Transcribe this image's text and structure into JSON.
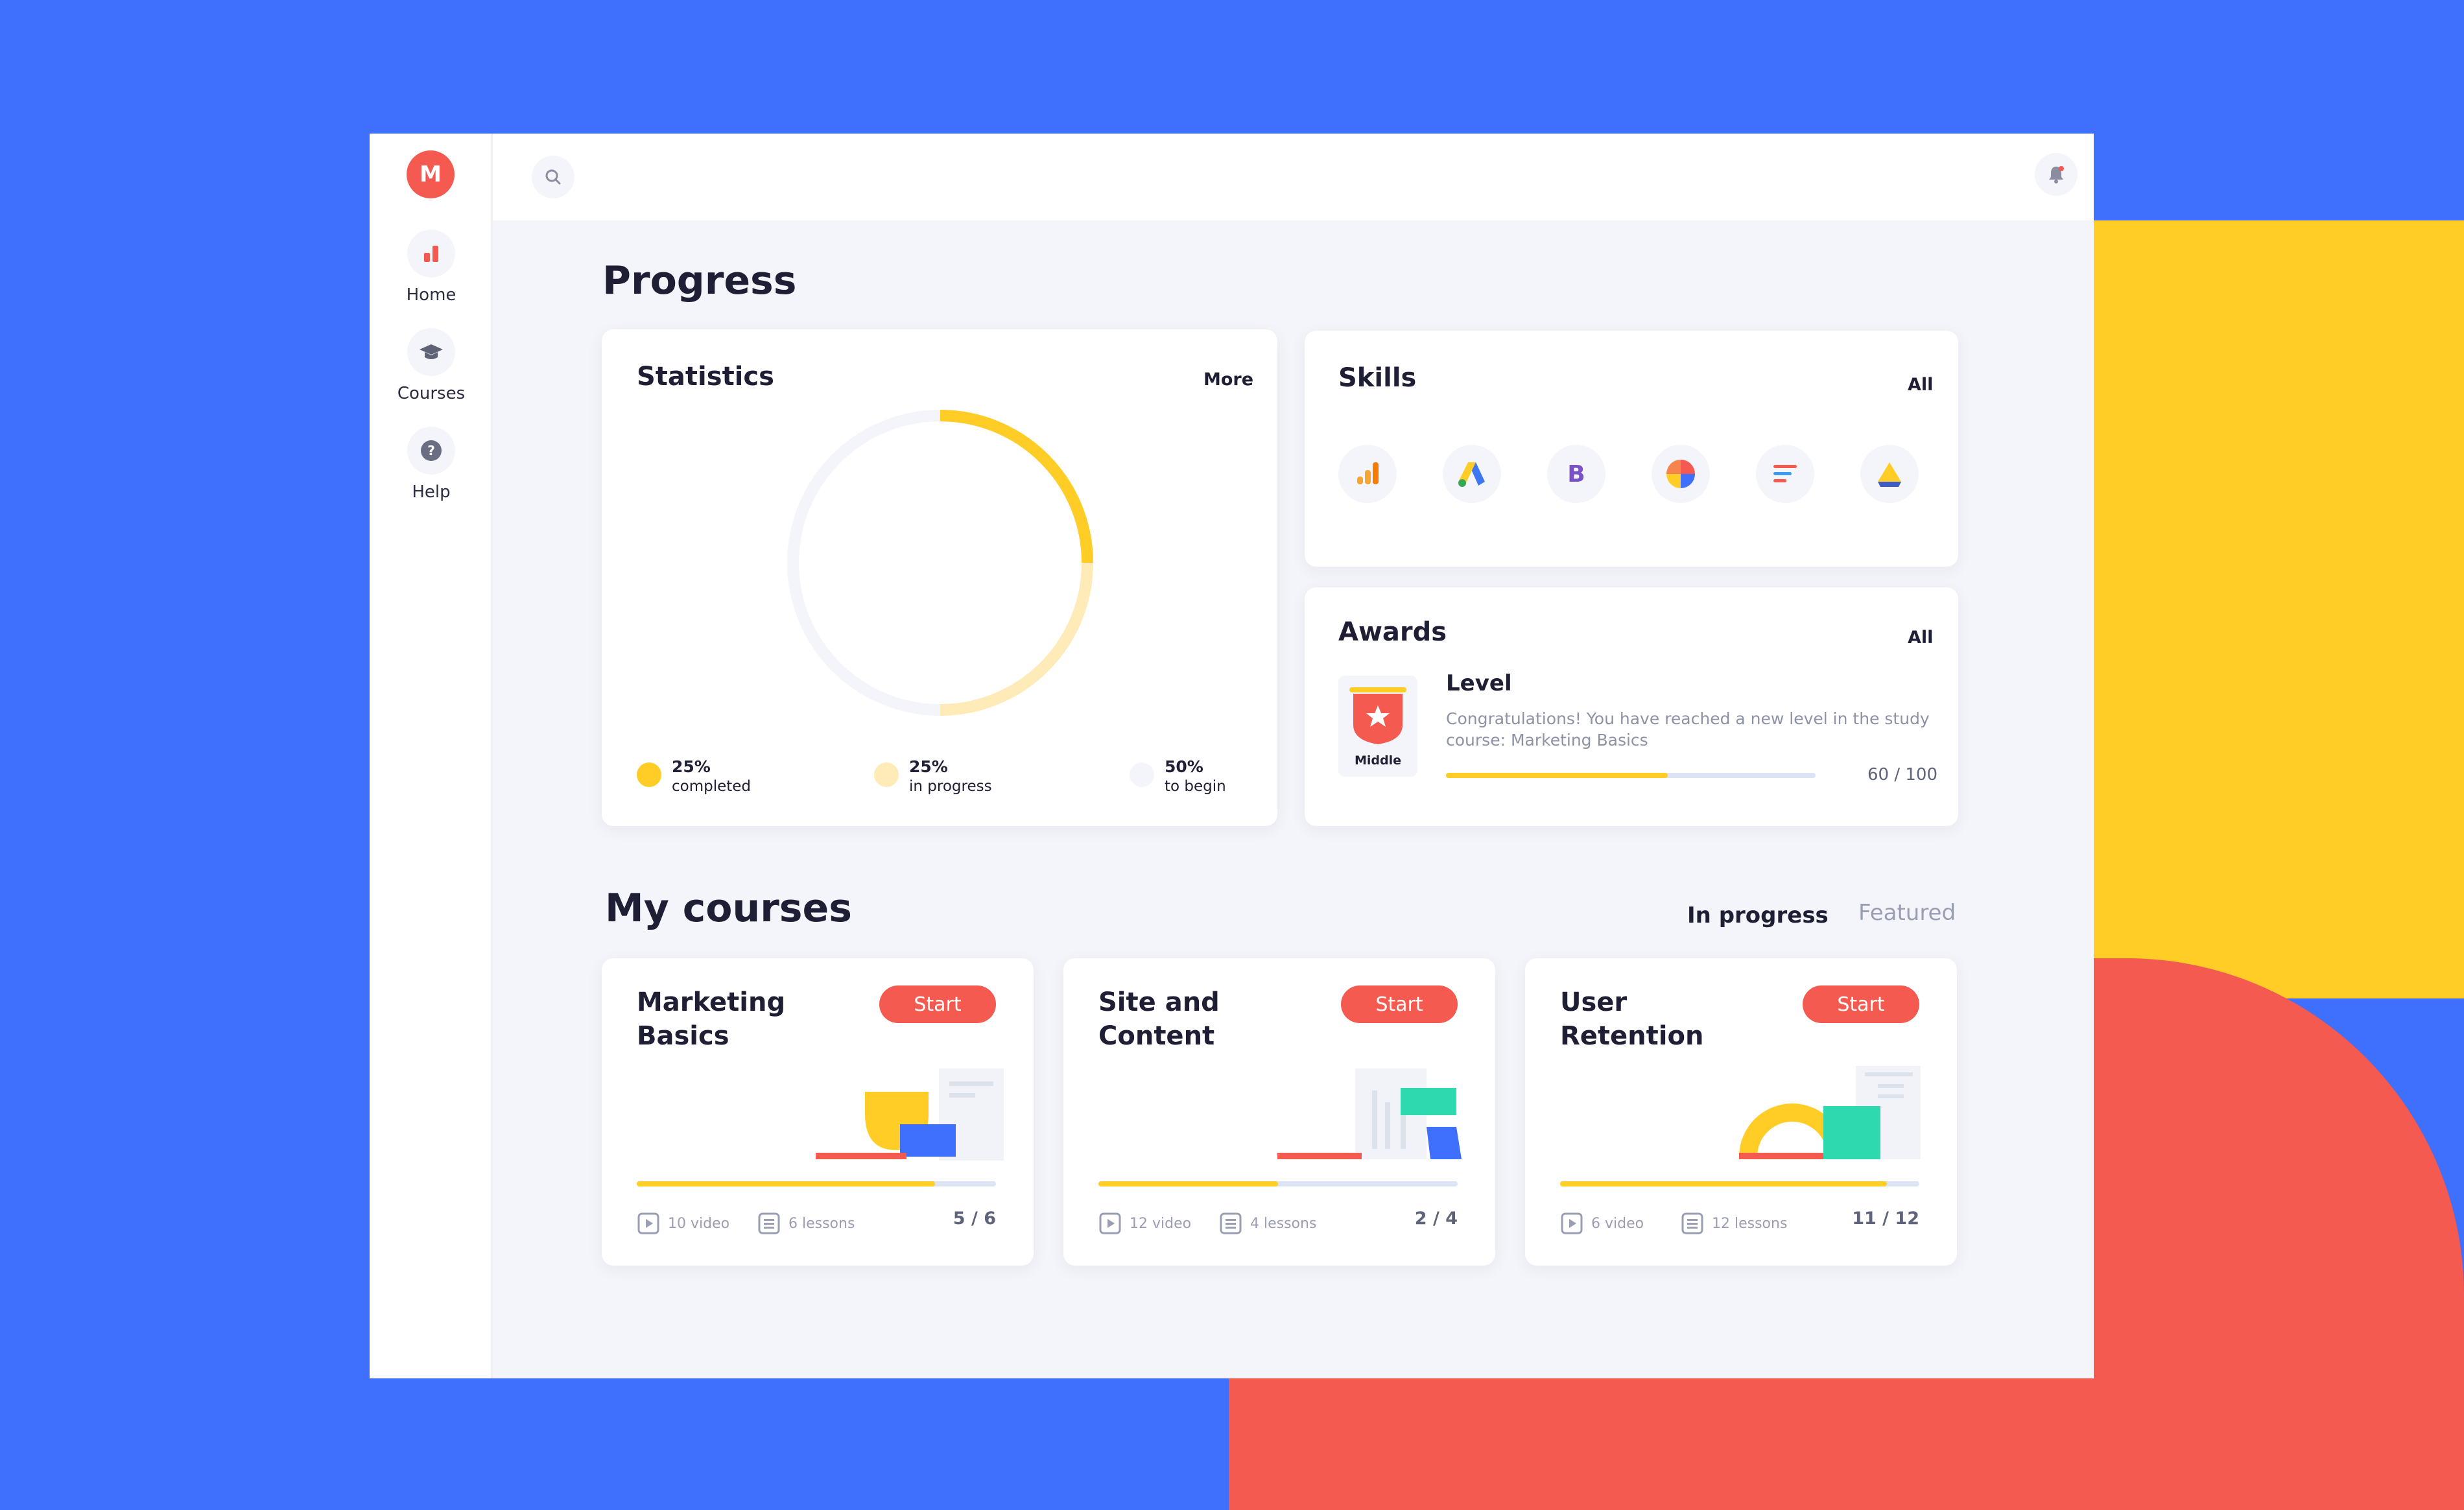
{
  "sidebar": {
    "logo_letter": "M",
    "items": [
      {
        "label": "Home",
        "icon": "bar-chart-icon"
      },
      {
        "label": "Courses",
        "icon": "graduation-cap-icon"
      },
      {
        "label": "Help",
        "icon": "question-icon"
      }
    ]
  },
  "page": {
    "title": "Progress"
  },
  "statistics": {
    "title": "Statistics",
    "more_label": "More",
    "segments": [
      {
        "pct": "25%",
        "label": "completed",
        "value": 25,
        "color": "#FFCD26"
      },
      {
        "pct": "25%",
        "label": "in progress",
        "value": 25,
        "color": "#FFEBB8"
      },
      {
        "pct": "50%",
        "label": "to begin",
        "value": 50,
        "color": "#F4F5FA"
      }
    ]
  },
  "skills": {
    "title": "Skills",
    "all_label": "All",
    "icons": [
      "google-analytics-icon",
      "google-ads-icon",
      "bootstrap-icon",
      "pie-chart-icon",
      "google-tag-manager-icon",
      "google-drive-icon"
    ]
  },
  "awards": {
    "title": "Awards",
    "all_label": "All",
    "badge_label": "Middle",
    "level_title": "Level",
    "description": "Congratulations! You have reached a new level in the study course: Marketing Basics",
    "score_label": "60 / 100",
    "progress": 0.6
  },
  "courses": {
    "title": "My courses",
    "tabs": [
      {
        "label": "In progress",
        "active": true
      },
      {
        "label": "Featured",
        "active": false
      }
    ],
    "start_label": "Start",
    "items": [
      {
        "title": "Marketing Basics",
        "videos": "10 video",
        "lessons": "6 lessons",
        "count": "5 / 6",
        "progress": 0.83
      },
      {
        "title": "Site and Content",
        "videos": "12 video",
        "lessons": "4 lessons",
        "count": "2 / 4",
        "progress": 0.5
      },
      {
        "title": "User Retention",
        "videos": "6 video",
        "lessons": "12 lessons",
        "count": "11 / 12",
        "progress": 0.91
      }
    ]
  },
  "colors": {
    "background_blue": "#3E6FFD",
    "accent_yellow": "#FFCD26",
    "accent_red": "#F55A50",
    "panel": "#F4F5FA"
  }
}
